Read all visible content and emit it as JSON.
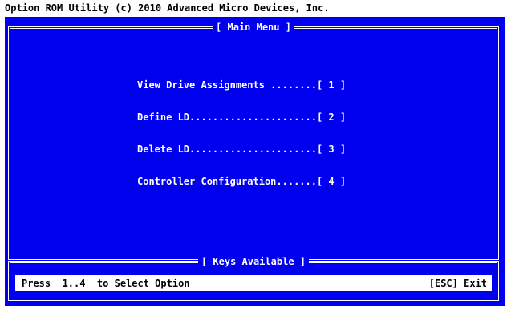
{
  "app": {
    "title": "Option ROM Utility (c) 2010 Advanced Micro Devices, Inc."
  },
  "main_menu": {
    "title": "[ Main Menu ]",
    "items": [
      {
        "label": "View Drive Assignments ........[ 1 ]"
      },
      {
        "label": "Define LD......................[ 2 ]"
      },
      {
        "label": "Delete LD......................[ 3 ]"
      },
      {
        "label": "Controller Configuration.......[ 4 ]"
      }
    ]
  },
  "keys": {
    "title": "[ Keys Available ]",
    "hint": "Press  1..4  to Select Option",
    "exit": "[ESC] Exit"
  },
  "colors": {
    "background": "#0000ee",
    "text": "#ffffff",
    "status_bar": "#ffffff"
  }
}
